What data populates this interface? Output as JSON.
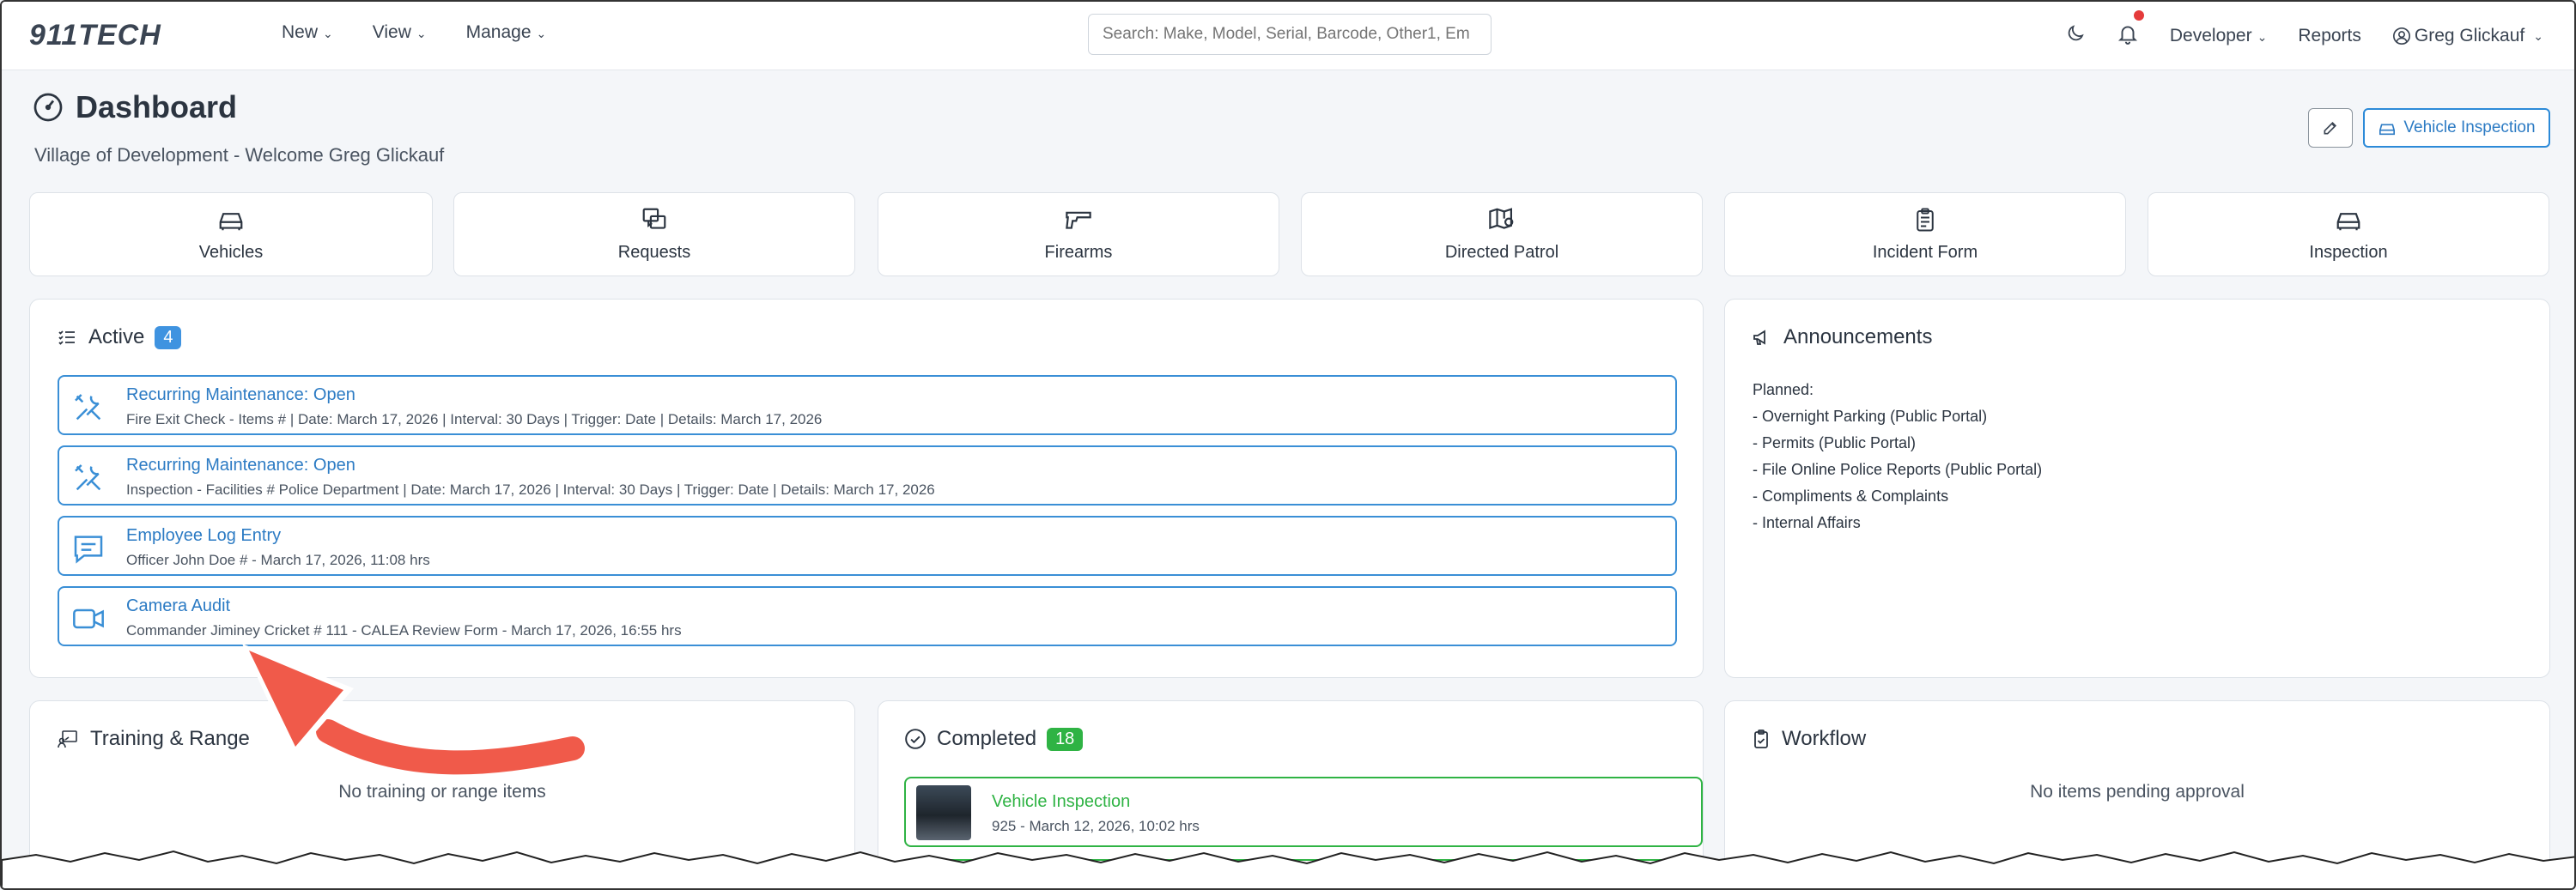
{
  "navbar": {
    "brand": "911TECH",
    "menu": [
      "New",
      "View",
      "Manage"
    ],
    "search_placeholder": "Search: Make, Model, Serial, Barcode, Other1, Em",
    "developer_label": "Developer",
    "reports_label": "Reports",
    "user_label": "Greg Glickauf"
  },
  "header": {
    "title": "Dashboard",
    "subtitle": "Village of Development - Welcome Greg Glickauf",
    "vehicle_inspection_label": "Vehicle Inspection"
  },
  "tiles": [
    {
      "label": "Vehicles",
      "icon": "car-icon"
    },
    {
      "label": "Requests",
      "icon": "requests-icon"
    },
    {
      "label": "Firearms",
      "icon": "firearm-icon"
    },
    {
      "label": "Directed Patrol",
      "icon": "map-pin-icon"
    },
    {
      "label": "Incident Form",
      "icon": "clipboard-icon"
    },
    {
      "label": "Inspection",
      "icon": "car-icon"
    }
  ],
  "active": {
    "title": "Active",
    "count": "4",
    "items": [
      {
        "title": "Recurring Maintenance: Open",
        "subtitle": "Fire Exit Check - Items # | Date: March 17, 2026 | Interval: 30 Days | Trigger: Date | Details: March 17, 2026",
        "icon": "tools-icon"
      },
      {
        "title": "Recurring Maintenance: Open",
        "subtitle": "Inspection - Facilities # Police Department | Date: March 17, 2026 | Interval: 30 Days | Trigger: Date | Details: March 17, 2026",
        "icon": "tools-icon"
      },
      {
        "title": "Employee Log Entry",
        "subtitle": "Officer John Doe # - March 17, 2026, 11:08 hrs",
        "icon": "message-icon"
      },
      {
        "title": "Camera Audit",
        "subtitle": "Commander Jiminey Cricket # 111 - CALEA Review Form - March 17, 2026, 16:55 hrs",
        "icon": "video-camera-icon"
      }
    ]
  },
  "announcements": {
    "title": "Announcements",
    "lines": [
      "Planned:",
      "- Overnight Parking (Public Portal)",
      "- Permits (Public Portal)",
      "- File Online Police Reports (Public Portal)",
      "- Compliments & Complaints",
      "- Internal Affairs"
    ]
  },
  "training": {
    "title": "Training & Range",
    "empty": "No training or range items"
  },
  "completed": {
    "title": "Completed",
    "count": "18",
    "items": [
      {
        "title": "Vehicle Inspection",
        "subtitle": "925 - March 12, 2026, 10:02 hrs"
      }
    ]
  },
  "workflow": {
    "title": "Workflow",
    "empty": "No items pending approval"
  },
  "colors": {
    "accent_blue": "#3f93e0",
    "success_green": "#2fb344",
    "annotation_arrow": "#f05a4a",
    "notification_dot": "#e53b3b"
  }
}
